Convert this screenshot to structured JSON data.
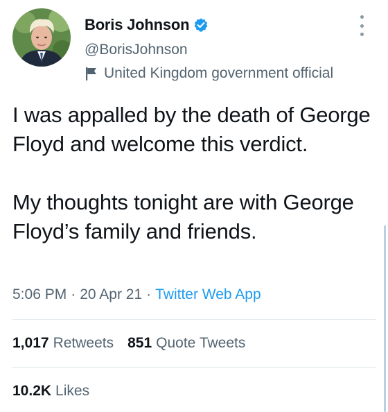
{
  "author": {
    "display_name": "Boris Johnson",
    "handle": "@BorisJohnson",
    "label": "United Kingdom government official",
    "verified": true
  },
  "tweet": {
    "paragraphs": [
      "I was appalled by the death of George Floyd and welcome this verdict.",
      "My thoughts tonight are with George Floyd’s family and friends."
    ],
    "time": "5:06 PM",
    "date": "20 Apr 21",
    "source": "Twitter Web App",
    "separator": "·"
  },
  "stats": {
    "retweets_count": "1,017",
    "retweets_label": "Retweets",
    "quote_count": "851",
    "quote_label": "Quote Tweets",
    "likes_count": "10.2K",
    "likes_label": "Likes"
  },
  "colors": {
    "text": "#0f1419",
    "secondary": "#536471",
    "accent": "#1d9bf0"
  },
  "icons": {
    "verified": "verified-badge-icon",
    "label": "flag-icon",
    "more": "more-vertical-icon"
  }
}
